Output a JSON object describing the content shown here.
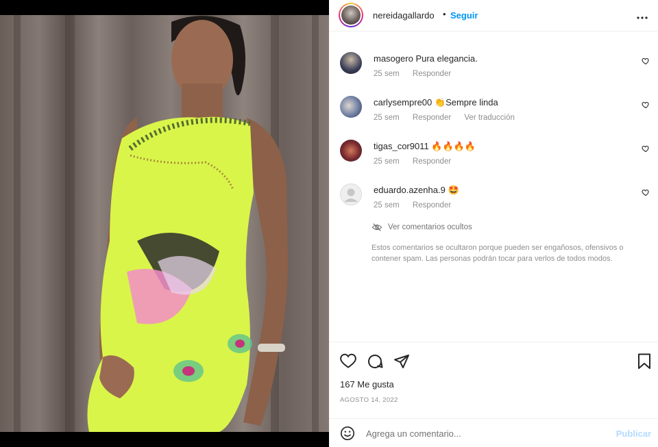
{
  "post": {
    "author": "nereidagallardo",
    "dot": "•",
    "follow_label": "Seguir",
    "more_label": "•••"
  },
  "comments": [
    {
      "user": "masogero",
      "text": "Pura elegancia.",
      "time": "25 sem",
      "reply": "Responder",
      "translate": ""
    },
    {
      "user": "carlysempre00",
      "text": "👏Sempre linda",
      "time": "25 sem",
      "reply": "Responder",
      "translate": "Ver traducción"
    },
    {
      "user": "tigas_cor9011",
      "text": "🔥🔥🔥🔥",
      "time": "25 sem",
      "reply": "Responder",
      "translate": ""
    },
    {
      "user": "eduardo.azenha.9",
      "text": "🤩",
      "time": "25 sem",
      "reply": "Responder",
      "translate": ""
    }
  ],
  "hidden": {
    "label": "Ver comentarios ocultos",
    "note": "Estos comentarios se ocultaron porque pueden ser engañosos, ofensivos o contener spam. Las personas podrán tocar para verlos de todos modos."
  },
  "stats": {
    "likes": "167 Me gusta",
    "date": "AGOSTO 14, 2022"
  },
  "composer": {
    "placeholder": "Agrega un comentario...",
    "publish_label": "Publicar"
  },
  "icons": {
    "like": "heart-icon",
    "comment": "comment-icon",
    "share": "share-icon",
    "save": "bookmark-icon",
    "emoji": "emoji-icon",
    "hidden": "eye-slash-icon"
  },
  "colors": {
    "accent": "#0095f6",
    "publish_disabled": "#b3dbff",
    "muted": "#8e8e8e",
    "dress": "#d9f54a"
  }
}
